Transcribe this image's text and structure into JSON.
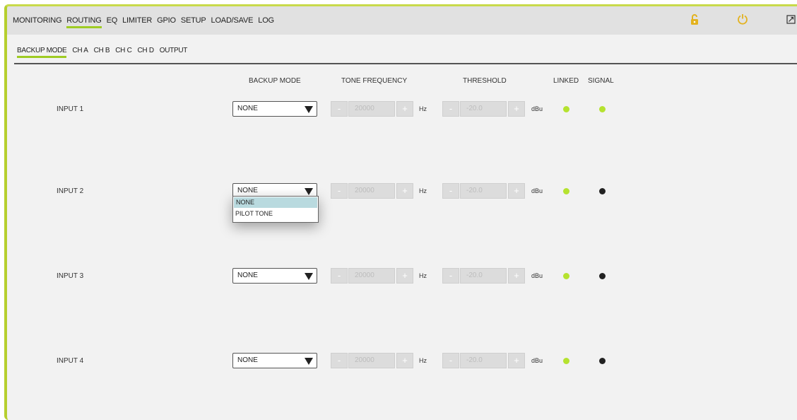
{
  "nav": {
    "main_tabs": [
      "MONITORING",
      "ROUTING",
      "EQ",
      "LIMITER",
      "GPIO",
      "SETUP",
      "LOAD/SAVE",
      "LOG"
    ],
    "active_main": "ROUTING",
    "sub_tabs": [
      "BACKUP MODE",
      "CH A",
      "CH B",
      "CH C",
      "CH D",
      "OUTPUT"
    ],
    "active_sub": "BACKUP MODE"
  },
  "icons": {
    "lock": "unlock-icon",
    "power": "power-icon",
    "expand": "fullscreen-icon"
  },
  "colors": {
    "accent": "#9ecb23",
    "led_on": "#b5e22f",
    "led_off": "#222222"
  },
  "columns": {
    "backup_mode": "BACKUP MODE",
    "tone_frequency": "TONE FREQUENCY",
    "threshold": "THRESHOLD",
    "linked": "LINKED",
    "signal": "SIGNAL"
  },
  "rows": [
    {
      "label": "INPUT 1",
      "mode": "NONE",
      "freq_minus": "-",
      "freq": "20000",
      "freq_plus": "+",
      "freq_unit": "Hz",
      "thr_minus": "-",
      "thr": "-20.0",
      "thr_plus": "+",
      "thr_unit": "dBu",
      "linked": "on",
      "signal": "on"
    },
    {
      "label": "INPUT 2",
      "mode": "NONE",
      "freq_minus": "-",
      "freq": "20000",
      "freq_plus": "+",
      "freq_unit": "Hz",
      "thr_minus": "-",
      "thr": "-20.0",
      "thr_plus": "+",
      "thr_unit": "dBu",
      "linked": "on",
      "signal": "off"
    },
    {
      "label": "INPUT 3",
      "mode": "NONE",
      "freq_minus": "-",
      "freq": "20000",
      "freq_plus": "+",
      "freq_unit": "Hz",
      "thr_minus": "-",
      "thr": "-20.0",
      "thr_plus": "+",
      "thr_unit": "dBu",
      "linked": "on",
      "signal": "off"
    },
    {
      "label": "INPUT 4",
      "mode": "NONE",
      "freq_minus": "-",
      "freq": "20000",
      "freq_plus": "+",
      "freq_unit": "Hz",
      "thr_minus": "-",
      "thr": "-20.0",
      "thr_plus": "+",
      "thr_unit": "dBu",
      "linked": "on",
      "signal": "off"
    }
  ],
  "dropdown_options": [
    "NONE",
    "PILOT TONE"
  ],
  "dropdown_selected": "NONE"
}
